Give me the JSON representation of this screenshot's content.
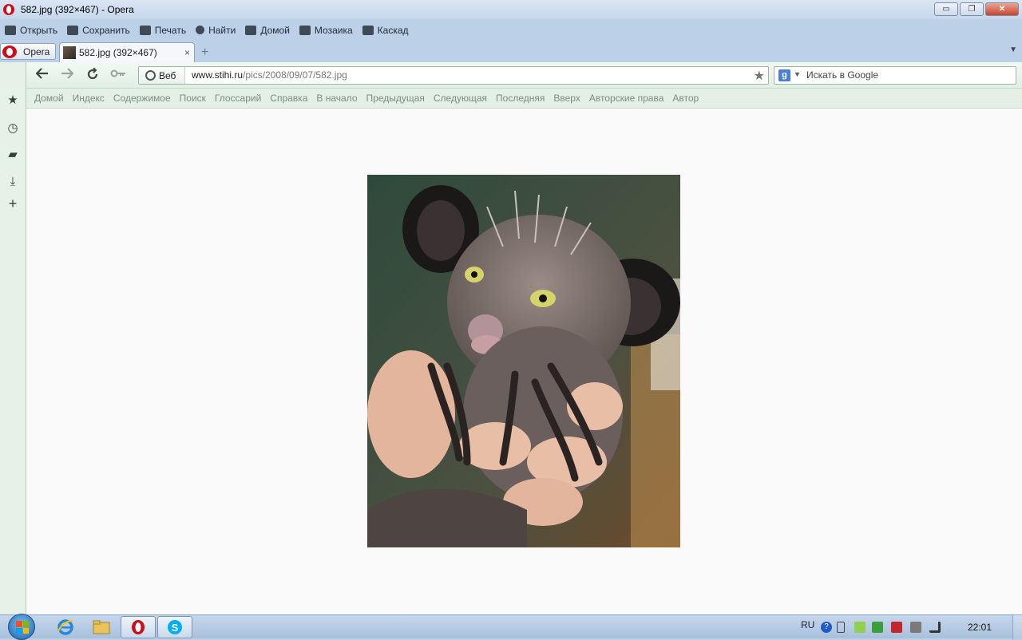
{
  "window": {
    "title": "582.jpg (392×467) - Opera",
    "buttons": {
      "minimize": "▭",
      "restore": "❐",
      "close": "✕"
    }
  },
  "menubar": {
    "items": [
      {
        "label": "Открыть",
        "icon": "folder-icon"
      },
      {
        "label": "Сохранить",
        "icon": "save-icon"
      },
      {
        "label": "Печать",
        "icon": "print-icon"
      },
      {
        "label": "Найти",
        "icon": "find-icon"
      },
      {
        "label": "Домой",
        "icon": "home-icon"
      },
      {
        "label": "Мозаика",
        "icon": "tile-icon"
      },
      {
        "label": "Каскад",
        "icon": "cascade-icon"
      }
    ]
  },
  "tabs": {
    "opera_menu": "Opera",
    "active": {
      "label": "582.jpg (392×467)",
      "close": "×"
    },
    "new_tab": "+",
    "tab_menu": "▼"
  },
  "navigation": {
    "back": "🡠",
    "forward": "🡢",
    "reload": "↻",
    "key": "⚿",
    "address": {
      "badge": "Веб",
      "domain": "www.stihi.ru",
      "path": "/pics/2008/09/07/582.jpg"
    },
    "bookmark_star": "★",
    "search": {
      "engine": "g",
      "placeholder": "Искать в Google"
    }
  },
  "linkbar": {
    "links": [
      "Домой",
      "Индекс",
      "Содержимое",
      "Поиск",
      "Глоссарий",
      "Справка",
      "В начало",
      "Предыдущая",
      "Следующая",
      "Последняя",
      "Вверх",
      "Авторские права",
      "Автор"
    ]
  },
  "sidebar": {
    "icons": [
      "bookmarks-star-icon",
      "history-clock-icon",
      "notes-icon",
      "downloads-icon",
      "add-panel-icon"
    ],
    "glyphs": [
      "★",
      "◷",
      "▰",
      "⤓",
      "+"
    ]
  },
  "image": {
    "description_name": "aye-aye-photo"
  },
  "taskbar": {
    "apps": [
      "internet-explorer-icon",
      "explorer-folder-icon",
      "opera-icon",
      "skype-icon"
    ],
    "tray": {
      "lang": "RU",
      "help": "?",
      "clock": "22:01"
    }
  },
  "colors": {
    "accent": "#cc0f16",
    "sidebar": "#e6f2e8",
    "chrome": "#bcd0e8"
  }
}
